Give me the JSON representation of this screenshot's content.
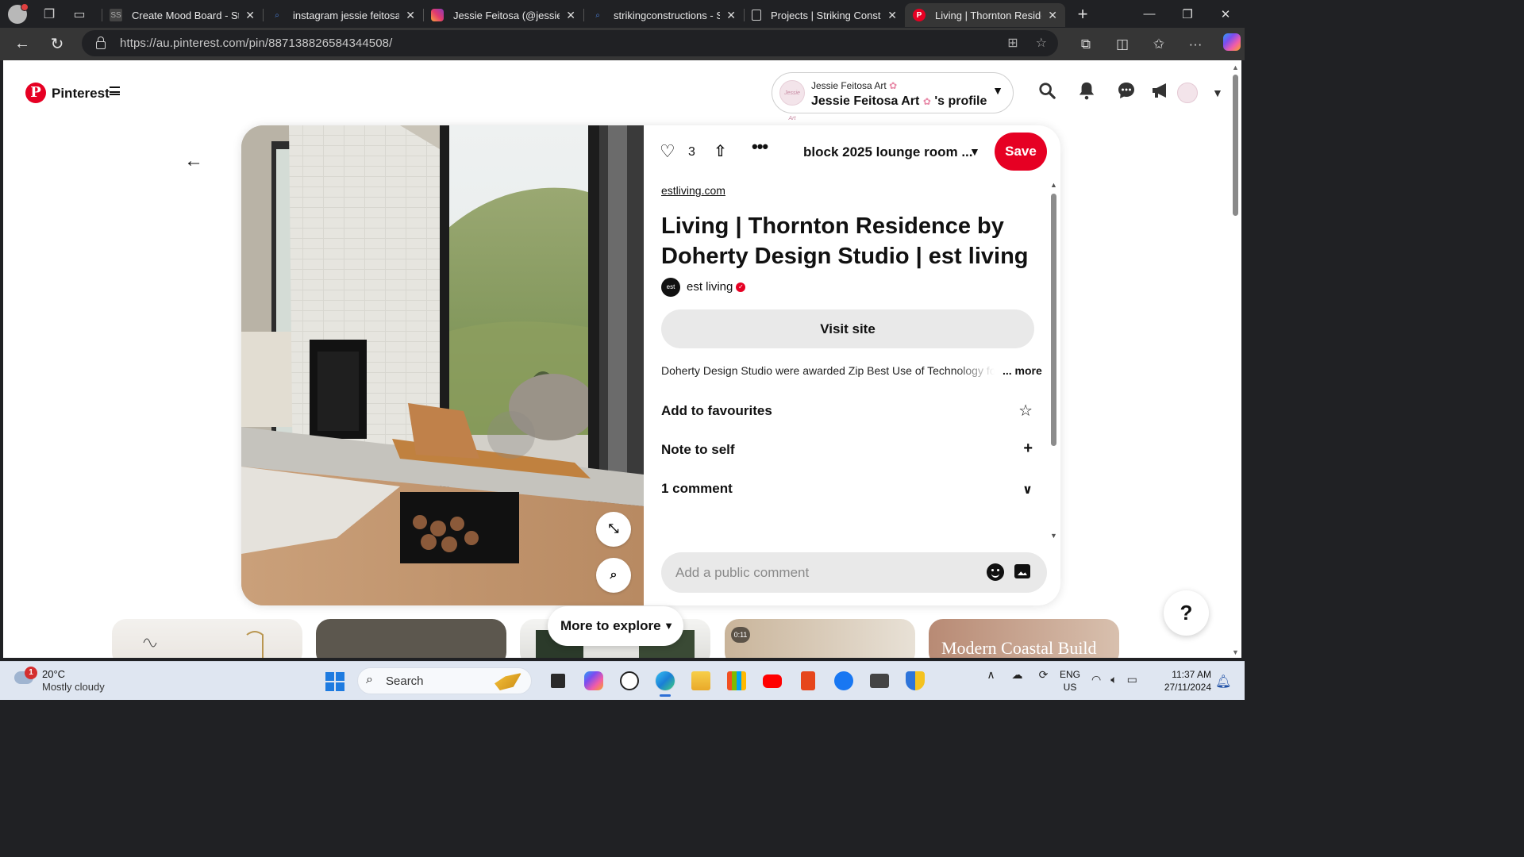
{
  "browser": {
    "tabs": [
      {
        "title": "Create Mood Board - Styl",
        "favicon": "stack-icon"
      },
      {
        "title": "instagram jessie feitosa - S",
        "favicon": "search-icon"
      },
      {
        "title": "Jessie Feitosa (@jessie_fei",
        "favicon": "instagram-icon"
      },
      {
        "title": "strikingconstructions - Se",
        "favicon": "search-icon"
      },
      {
        "title": "Projects | Striking Constru",
        "favicon": "page-icon"
      },
      {
        "title": "Living | Thornton Residen",
        "favicon": "pinterest-icon",
        "active": true
      }
    ],
    "url": "https://au.pinterest.com/pin/887138826584344508/"
  },
  "header": {
    "brand": "Pinterest",
    "profile": {
      "small_label": "Jessie Feitosa Art",
      "big_label_name": "Jessie Feitosa Art",
      "big_label_suffix": "'s profile",
      "avatar_text": "Jessie Art"
    }
  },
  "pin": {
    "like_count": "3",
    "board": "block 2025 lounge room ...",
    "save_label": "Save",
    "source": "estliving.com",
    "title": "Living | Thornton Residence by Doherty Design Studio | est living",
    "author": "est living",
    "author_avatar_text": "est",
    "visit_label": "Visit site",
    "description": "Doherty Design Studio were awarded Zip Best Use of Technology fo",
    "more_label": "... more",
    "rows": [
      {
        "label": "Add to favourites",
        "icon": "star-outline-icon"
      },
      {
        "label": "Note to self",
        "icon": "plus-icon"
      },
      {
        "label": "1 comment",
        "icon": "chevron-down-icon"
      }
    ],
    "comment_placeholder": "Add a public comment"
  },
  "explore": {
    "button_label": "More to explore",
    "video_duration": "0:11",
    "card_text": "Modern Coastal Build"
  },
  "help_label": "?",
  "taskbar": {
    "weather_temp": "20°C",
    "weather_desc": "Mostly cloudy",
    "weather_badge": "1",
    "search_label": "Search",
    "lang_line1": "ENG",
    "lang_line2": "US",
    "time": "11:37 AM",
    "date": "27/11/2024"
  }
}
